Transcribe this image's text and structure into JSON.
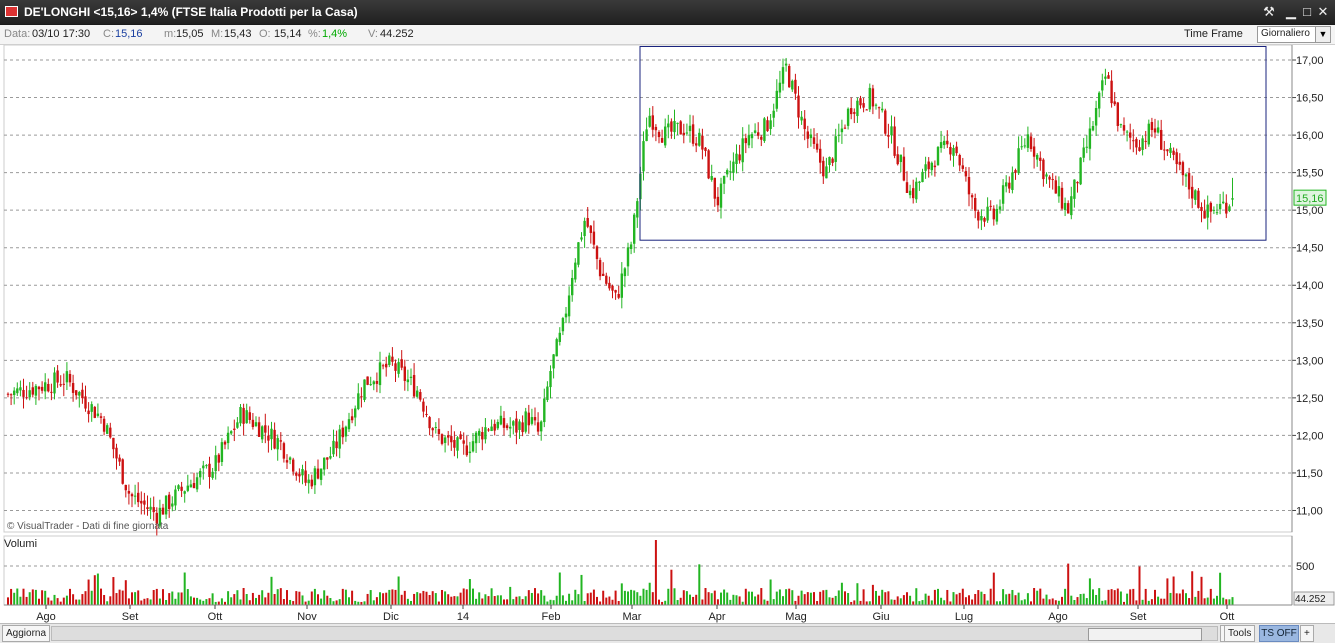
{
  "window": {
    "title": "DE'LONGHI <15,16> 1,4%  (FTSE Italia Prodotti per la Casa)"
  },
  "info": {
    "data_label": "Data:",
    "data_value": "03/10 17:30",
    "c_label": "C:",
    "c_value": "15,16",
    "m_label": "m:",
    "m_value": "15,05",
    "M_label": "M:",
    "M_value": "15,43",
    "o_label": "O:",
    "o_value": "15,14",
    "pct_label": "%:",
    "pct_value": "1,4%",
    "v_label": "V:",
    "v_value": "44.252",
    "timeframe_label": "Time Frame",
    "timeframe_value": "Giornaliero"
  },
  "watermark": "© VisualTrader - Dati di fine giornata",
  "volume_label": "Volumi",
  "bottom": {
    "aggiorna": "Aggiorna",
    "tools": "Tools",
    "tsoff": "TS OFF",
    "plus": "+",
    "arrow": "►"
  },
  "colors": {
    "up": "#22b522",
    "down": "#cc1111",
    "grid": "#9a9a9a",
    "rect": "#1a237e",
    "last_price_bg": "#dff5df",
    "last_price_fg": "#22aa22"
  },
  "chart_data": {
    "type": "candlestick",
    "price_axis": {
      "ylim": [
        10.7,
        17.2
      ],
      "ticks": [
        11.0,
        11.5,
        12.0,
        12.5,
        13.0,
        13.5,
        14.0,
        14.5,
        15.0,
        15.5,
        16.0,
        16.5,
        17.0
      ],
      "tick_labels": [
        "11,00",
        "11,50",
        "12,00",
        "12,50",
        "13,00",
        "13,50",
        "14,00",
        "14,50",
        "15,00",
        "15,50",
        "16,00",
        "16,50",
        "17,00"
      ]
    },
    "volume_axis": {
      "tick": 500,
      "tick_label": "500",
      "last_label": "44.252"
    },
    "last_price": {
      "value": 15.16,
      "label": "15,16"
    },
    "x_labels": [
      "Ago",
      "Set",
      "Ott",
      "Nov",
      "Dic",
      "14",
      "Feb",
      "Mar",
      "Apr",
      "Mag",
      "Giu",
      "Lug",
      "Ago",
      "Set",
      "Ott"
    ],
    "range_box": {
      "from_month": "Mar",
      "to_month": "Ott",
      "high": 17.18,
      "low": 14.6
    },
    "anchors": [
      [
        "Ago",
        12.55
      ],
      [
        "Ago",
        12.75
      ],
      [
        "Set",
        12.2
      ],
      [
        "Set",
        11.2
      ],
      [
        "Set",
        10.95
      ],
      [
        "Ott",
        11.35
      ],
      [
        "Ott",
        11.6
      ],
      [
        "Ott",
        12.3
      ],
      [
        "Nov",
        11.9
      ],
      [
        "Nov",
        11.35
      ],
      [
        "Nov",
        11.8
      ],
      [
        "Dic",
        12.7
      ],
      [
        "Dic",
        12.95
      ],
      [
        "Dic",
        12.6
      ],
      [
        "14",
        12.0
      ],
      [
        "14",
        11.8
      ],
      [
        "14",
        12.15
      ],
      [
        "Feb",
        12.1
      ],
      [
        "Feb",
        12.25
      ],
      [
        "Feb",
        12.0
      ],
      [
        "Feb",
        12.9
      ],
      [
        "Feb",
        13.4
      ],
      [
        "Feb",
        14.3
      ],
      [
        "Feb",
        14.9
      ],
      [
        "Mar",
        14.2
      ],
      [
        "Mar",
        13.8
      ],
      [
        "Mar",
        14.6
      ],
      [
        "Mar",
        16.3
      ],
      [
        "Mar",
        16.0
      ],
      [
        "Apr",
        16.1
      ],
      [
        "Apr",
        15.9
      ],
      [
        "Apr",
        15.1
      ],
      [
        "Apr",
        15.6
      ],
      [
        "Apr",
        16.0
      ],
      [
        "Mag",
        16.1
      ],
      [
        "Mag",
        16.9
      ],
      [
        "Mag",
        16.0
      ],
      [
        "Mag",
        15.5
      ],
      [
        "Giu",
        16.4
      ],
      [
        "Giu",
        16.5
      ],
      [
        "Giu",
        16.0
      ],
      [
        "Giu",
        15.2
      ],
      [
        "Lug",
        15.7
      ],
      [
        "Lug",
        15.9
      ],
      [
        "Lug",
        15.0
      ],
      [
        "Lug",
        14.9
      ],
      [
        "Ago",
        16.0
      ],
      [
        "Ago",
        15.4
      ],
      [
        "Ago",
        15.0
      ],
      [
        "Ago",
        15.9
      ],
      [
        "Set",
        16.8
      ],
      [
        "Set",
        16.0
      ],
      [
        "Set",
        15.9
      ],
      [
        "Set",
        16.1
      ],
      [
        "Set",
        15.7
      ],
      [
        "Ott",
        14.95
      ],
      [
        "Ott",
        15.16
      ]
    ]
  }
}
